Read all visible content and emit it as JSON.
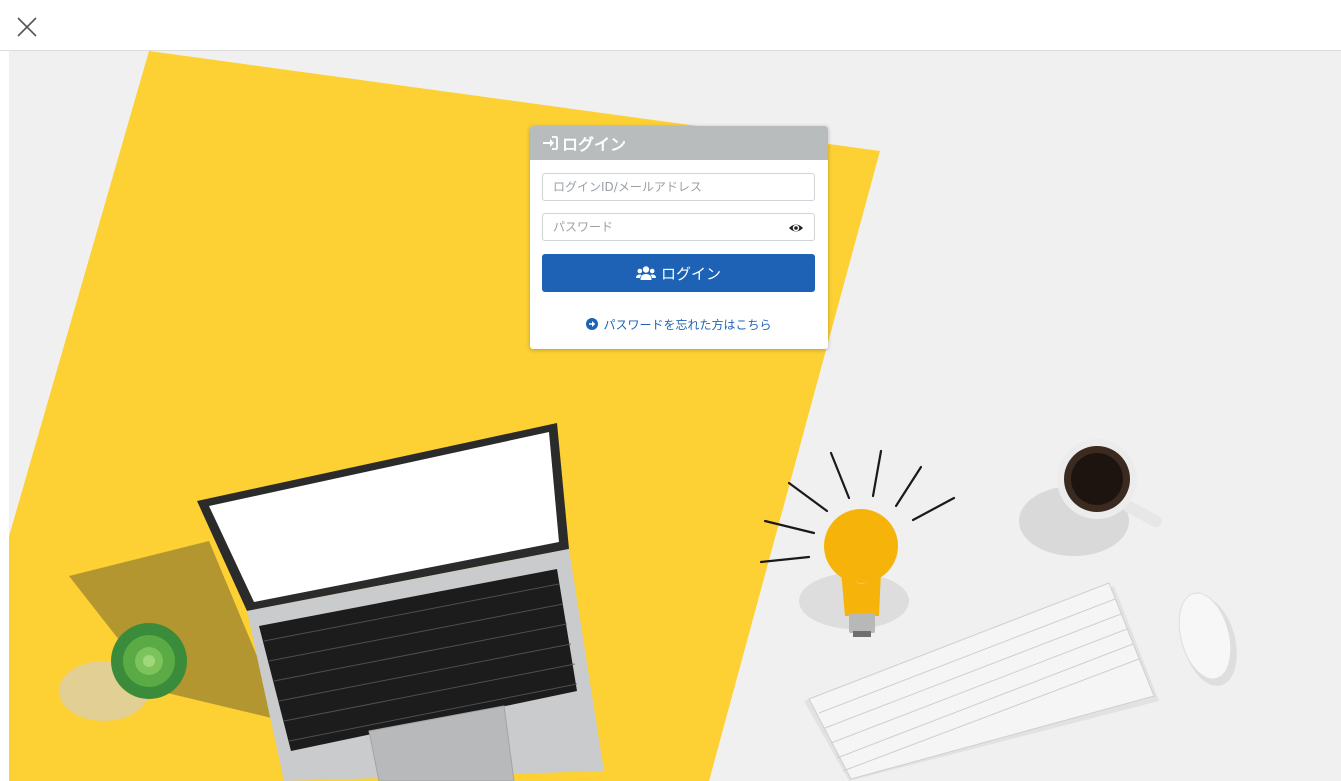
{
  "window": {
    "close_icon": "close-icon"
  },
  "login": {
    "title": "ログイン",
    "title_icon": "sign-in-icon",
    "id_placeholder": "ログインID/メールアドレス",
    "id_value": "",
    "password_placeholder": "パスワード",
    "password_value": "",
    "password_toggle_icon": "eye-icon",
    "button_label": "ログイン",
    "button_icon": "users-icon",
    "forgot_label": "パスワードを忘れた方はこちら",
    "forgot_icon": "arrow-circle-right-icon"
  },
  "colors": {
    "header_bg": "#b9bcbd",
    "primary": "#1d62b5",
    "yellow": "#fdd033",
    "background": "#f0f0f0"
  }
}
